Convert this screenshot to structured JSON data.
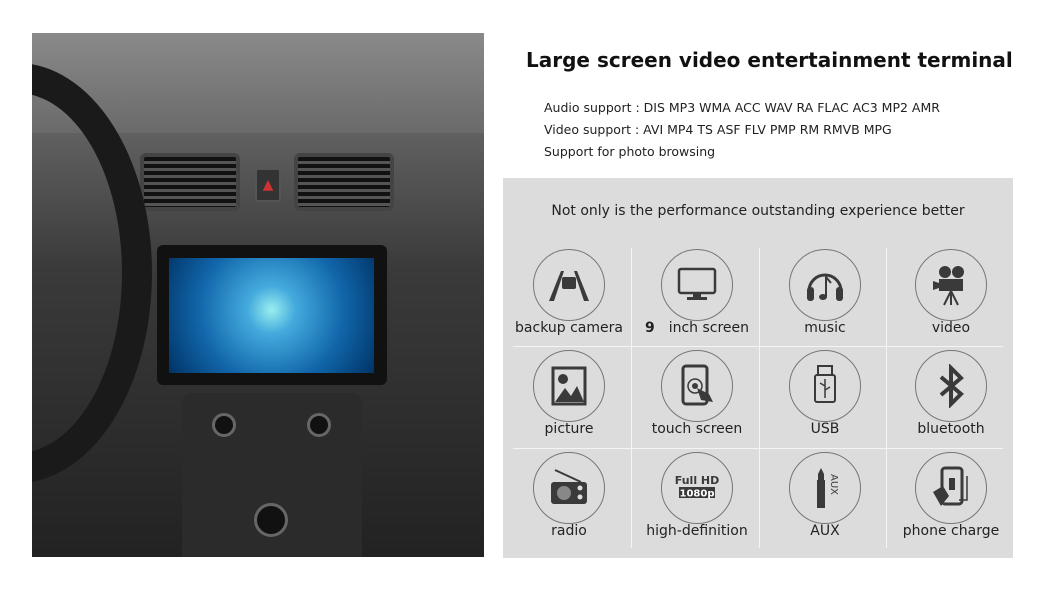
{
  "title": "Large screen video entertainment terminal",
  "specs": [
    "Audio support : DIS MP3 WMA ACC WAV RA FLAC AC3 MP2 AMR",
    "Video support : AVI MP4 TS ASF FLV PMP RM RMVB MPG",
    "Support for photo browsing"
  ],
  "panel": {
    "subtitle": "Not only is the performance outstanding experience better",
    "features": [
      {
        "label": "backup camera",
        "icon": "backup-camera-icon"
      },
      {
        "label": "inch screen",
        "prefix": "9",
        "icon": "monitor-icon"
      },
      {
        "label": "music",
        "icon": "headphones-music-icon"
      },
      {
        "label": "video",
        "icon": "film-projector-icon"
      },
      {
        "label": "picture",
        "icon": "picture-icon"
      },
      {
        "label": "touch screen",
        "icon": "touch-screen-icon"
      },
      {
        "label": "USB",
        "icon": "usb-icon"
      },
      {
        "label": "bluetooth",
        "icon": "bluetooth-icon"
      },
      {
        "label": "radio",
        "icon": "radio-icon"
      },
      {
        "label": "high-definition",
        "icon": "full-hd-icon",
        "badge": [
          "Full HD",
          "1080p"
        ]
      },
      {
        "label": "AUX",
        "icon": "aux-icon",
        "badge": [
          "AUX"
        ]
      },
      {
        "label": "phone charge",
        "icon": "phone-charge-icon"
      }
    ]
  },
  "colors": {
    "panel": "#dcdcdc",
    "icon": "#3a3a3a"
  }
}
